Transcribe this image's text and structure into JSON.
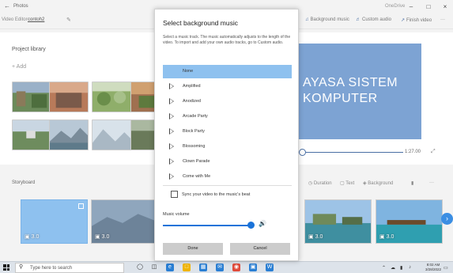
{
  "titlebar": {
    "app_name": "Photos",
    "onedrive": "OneDrive",
    "minimize": "–",
    "maximize": "□",
    "close": "×"
  },
  "subbar": {
    "crumb_editor": "Video Editor",
    "crumb_project": "contoh2",
    "tools": [
      "Background music",
      "Custom audio",
      "Finish video",
      "···"
    ]
  },
  "library": {
    "title": "Project library",
    "add_label": "+  Add"
  },
  "preview": {
    "text_line1": "AYASA SISTEM",
    "text_line2": "KOMPUTER",
    "time": "1:27.00",
    "scrub_fraction": 0.0
  },
  "storyboard": {
    "title": "Storyboard",
    "tools": [
      "Duration",
      "Text",
      "Background",
      "···"
    ],
    "cards": [
      {
        "duration": "3.0",
        "selected": true
      },
      {
        "duration": "3.0",
        "selected": false
      },
      {
        "duration": "3.0",
        "selected": false
      },
      {
        "duration": "3.0",
        "selected": false
      }
    ]
  },
  "dialog": {
    "title": "Select background music",
    "description": "Select a music track. The music automatically adjusts to the length of the video. To import and add your own audio tracks, go to Custom audio.",
    "tracks": [
      "None",
      "Amplified",
      "Anodized",
      "Arcade Party",
      "Block Party",
      "Blossoming",
      "Clown Parade",
      "Come with Me"
    ],
    "selected_track": "None",
    "sync_label": "Sync your video to the music's beat",
    "sync_checked": false,
    "volume_label": "Music volume",
    "volume_fraction": 1.0,
    "done_label": "Done",
    "cancel_label": "Cancel"
  },
  "taskbar": {
    "search_placeholder": "Type here to search",
    "time": "8:02 AM",
    "date": "3/28/2022"
  },
  "colors": {
    "accent": "#1a73d9",
    "selected_bg": "#8ec1ef",
    "preview_bg": "#7da3d3"
  }
}
